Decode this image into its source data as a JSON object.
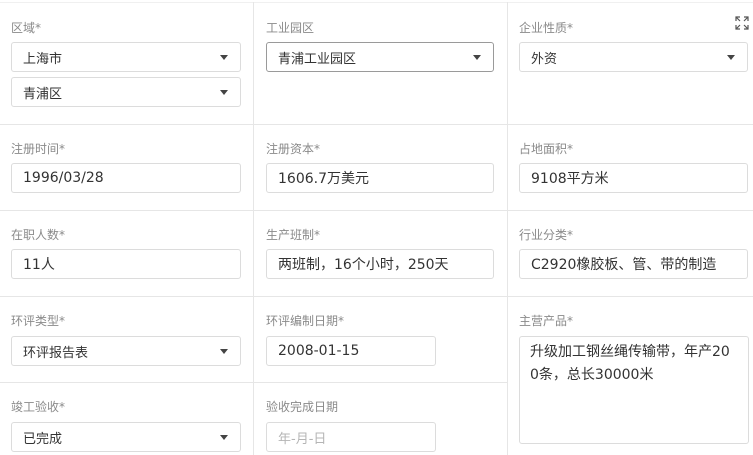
{
  "fields": {
    "region": {
      "label": "区域*",
      "province": "上海市",
      "district": "青浦区"
    },
    "industrial_park": {
      "label": "工业园区",
      "value": "青浦工业园区"
    },
    "enterprise_type": {
      "label": "企业性质*",
      "value": "外资"
    },
    "register_date": {
      "label": "注册时间*",
      "value": "1996/03/28"
    },
    "register_capital": {
      "label": "注册资本*",
      "value": "1606.7万美元"
    },
    "land_area": {
      "label": "占地面积*",
      "value": "9108平方米"
    },
    "employees": {
      "label": "在职人数*",
      "value": "11人"
    },
    "shift": {
      "label": "生产班制*",
      "value": "两班制，16个小时，250天"
    },
    "industry": {
      "label": "行业分类*",
      "value": "C2920橡胶板、管、带的制造"
    },
    "eia_type": {
      "label": "环评类型*",
      "value": "环评报告表"
    },
    "eia_date": {
      "label": "环评编制日期*",
      "value": "2008-01-15"
    },
    "main_product": {
      "label": "主营产品*",
      "value": "升级加工钢丝绳传输带，年产200条，总长30000米"
    },
    "acceptance": {
      "label": "竣工验收*",
      "value": "已完成"
    },
    "acceptance_date": {
      "label": "验收完成日期",
      "placeholder": "年-月-日"
    }
  },
  "icons": {
    "expand": "expand-icon",
    "caret": "chevron-down-icon"
  }
}
